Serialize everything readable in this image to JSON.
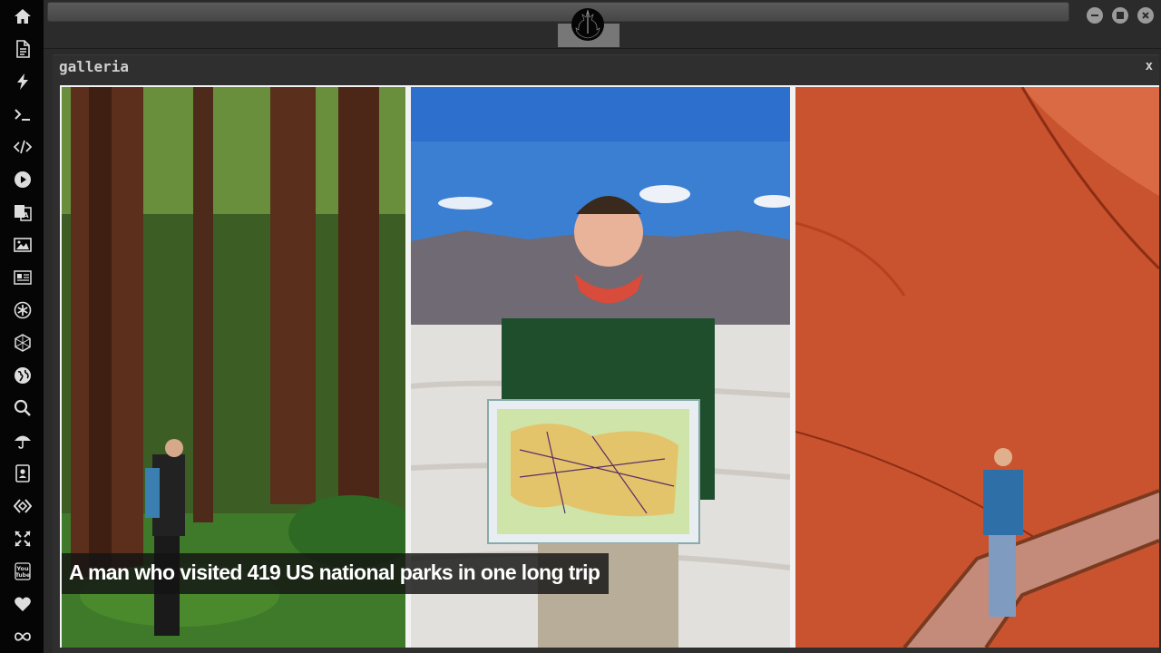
{
  "dock": {
    "items": [
      {
        "name": "home-icon"
      },
      {
        "name": "document-icon"
      },
      {
        "name": "lightning-icon"
      },
      {
        "name": "terminal-icon"
      },
      {
        "name": "code-icon"
      },
      {
        "name": "play-icon"
      },
      {
        "name": "translate-icon"
      },
      {
        "name": "image-icon"
      },
      {
        "name": "newspaper-icon"
      },
      {
        "name": "asterisk-circle-icon"
      },
      {
        "name": "hexagon-icon"
      },
      {
        "name": "globe-icon"
      },
      {
        "name": "search-icon"
      },
      {
        "name": "umbrella-icon"
      },
      {
        "name": "contact-book-icon"
      },
      {
        "name": "code-diamond-icon"
      },
      {
        "name": "expand-arrows-icon"
      },
      {
        "name": "youtube-icon"
      },
      {
        "name": "heart-icon"
      },
      {
        "name": "infinity-icon"
      }
    ]
  },
  "topbar": {
    "url_value": "",
    "logo": "rebel-alliance-icon",
    "controls": [
      "minimize-icon",
      "maximize-icon",
      "close-icon"
    ]
  },
  "window": {
    "title": "galleria",
    "close_label": "x"
  },
  "gallery": {
    "caption": "A man who visited 419 US national parks in one long trip",
    "photos": [
      "redwood-forest-hiker",
      "man-holding-us-map",
      "painted-hills-boardwalk"
    ]
  },
  "colors": {
    "dock_bg": "#050505",
    "chrome_bg": "#2b2b2b",
    "window_bg": "#2f2f2f",
    "caption_bg": "#141414"
  }
}
